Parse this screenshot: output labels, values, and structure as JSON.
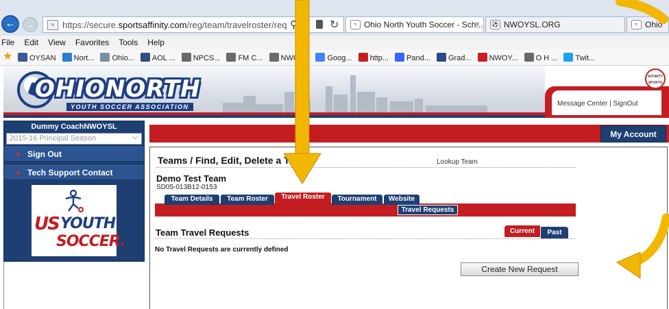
{
  "browser": {
    "url_prefix": "https://secure.",
    "url_domain": "sportsaffinity.com",
    "url_path": "/reg/team/travelroster/req",
    "tabs": [
      {
        "label": "Ohio North Youth Soccer - Sch...",
        "active": true
      },
      {
        "label": "NWOYSL.ORG",
        "active": false
      },
      {
        "label": "Ohio",
        "active": false
      }
    ],
    "menu": [
      "File",
      "Edit",
      "View",
      "Favorites",
      "Tools",
      "Help"
    ],
    "favorites": [
      {
        "label": "OYSAN",
        "icon": "oysan-icon",
        "color": "#3b5998"
      },
      {
        "label": "Nort...",
        "icon": "north-icon",
        "color": "#2b7cd3"
      },
      {
        "label": "Ohio...",
        "icon": "ohio-icon",
        "color": "#7a8fa6"
      },
      {
        "label": "AOL ...",
        "icon": "aol-icon",
        "color": "#2f4f7f"
      },
      {
        "label": "NPCS...",
        "icon": "npcs-icon",
        "color": "#6a6a6a"
      },
      {
        "label": "FM C...",
        "icon": "fmc-icon",
        "color": "#6a6a6a"
      },
      {
        "label": "NWOY...",
        "icon": "nwoy-icon",
        "color": "#6a6a6a"
      },
      {
        "label": "Goog...",
        "icon": "google-icon",
        "color": "#4285f4"
      },
      {
        "label": "http...",
        "icon": "sm-icon",
        "color": "#c31d22"
      },
      {
        "label": "Pand...",
        "icon": "pandora-icon",
        "color": "#3668ff"
      },
      {
        "label": "Grad...",
        "icon": "grade-icon",
        "color": "#2a4a8a"
      },
      {
        "label": "NWOY...",
        "icon": "pinterest-icon",
        "color": "#cb2027"
      },
      {
        "label": "O H ...",
        "icon": "oh-icon",
        "color": "#6a6a6a"
      },
      {
        "label": "Twit...",
        "icon": "twitter-icon",
        "color": "#1da1f2"
      }
    ]
  },
  "header": {
    "logo_text": "OHIONORTH",
    "logo_sub": "YOUTH SOCCER ASSOCIATION",
    "message_center": "Message Center",
    "separator": " | ",
    "sign_out": "SignOut",
    "affinity_logo_text": "AFFINITY SPORTS"
  },
  "sidebar": {
    "user_name": "Dummy CoachNWOYSL",
    "season": "2015-16 Principal Season",
    "items": [
      {
        "label": "Sign Out"
      },
      {
        "label": "Tech Support Contact"
      }
    ],
    "sponsor_logo": {
      "us": "US",
      "youth": "YOUTH",
      "soccer": "SOCCER."
    }
  },
  "main": {
    "my_account": "My Account",
    "page_title": "Teams / Find, Edit, Delete a Te",
    "lookup_team": "Lookup Team",
    "team_name": "Demo Test Team",
    "team_id": "SD05-013B12-0153",
    "tabs": [
      {
        "label": "Team Details",
        "active": false
      },
      {
        "label": "Team Roster",
        "active": false
      },
      {
        "label": "Travel Roster",
        "active": true
      },
      {
        "label": "Tournament",
        "active": false
      },
      {
        "label": "Website",
        "active": false
      }
    ],
    "subtab": "Travel Requests",
    "section_title": "Team Travel Requests",
    "filter_tabs": [
      {
        "label": "Current",
        "active": true
      },
      {
        "label": "Past",
        "active": false
      }
    ],
    "empty_message": "No Travel Requests are currently defined",
    "create_button": "Create New Request"
  },
  "colors": {
    "brand_red": "#c31d22",
    "brand_navy": "#1e3f72",
    "annotation_arrow": "#f2b705"
  }
}
